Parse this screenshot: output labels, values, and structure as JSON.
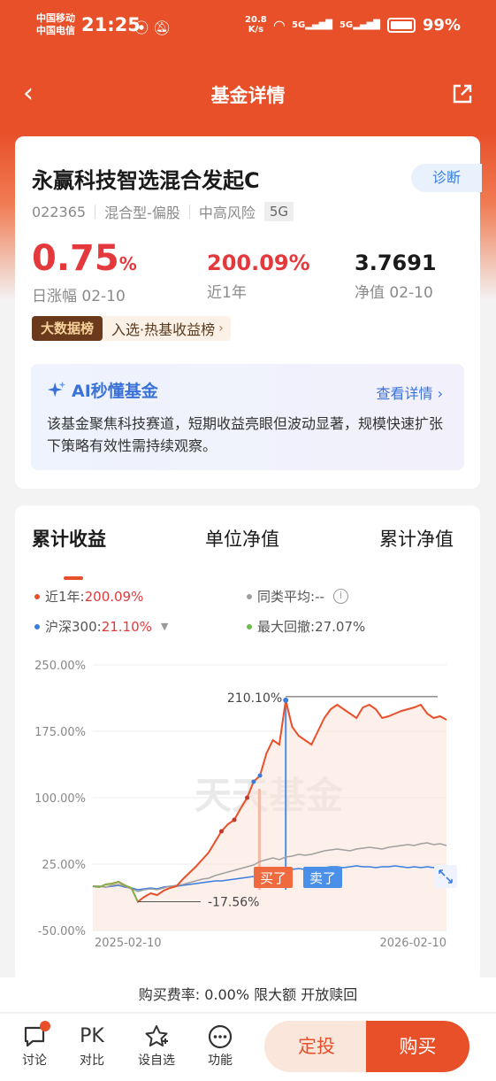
{
  "status_bar": {
    "carrier1": "中国移动",
    "carrier2": "中国电信",
    "time": "21:25",
    "speed": "20.8",
    "speed_unit": "K/s",
    "battery": "99%"
  },
  "nav": {
    "title": "基金详情"
  },
  "fund": {
    "name": "永赢科技智选混合发起C",
    "diagnose_label": "诊断",
    "code": "022365",
    "type": "混合型-偏股",
    "risk": "中高风险",
    "tag": "5G",
    "daily_change_value": "0.75",
    "daily_change_unit": "%",
    "daily_change_label": "日涨幅 02-10",
    "one_year_value": "200.09%",
    "one_year_label": "近1年",
    "nav_value": "3.7691",
    "nav_label": "净值 02-10",
    "rank_tag": "大数据榜",
    "rank_text": "入选·热基收益榜",
    "rank_chevron": "›"
  },
  "ai": {
    "title": "AI秒懂基金",
    "more": "查看详情",
    "more_chevron": "›",
    "text": "该基金聚焦科技赛道，短期收益亮眼但波动显著，规模快速扩张下策略有效性需持续观察。"
  },
  "tabs": [
    "累计收益",
    "单位净值",
    "累计净值"
  ],
  "legend": {
    "fund_label": "近1年:",
    "fund_value": "200.09%",
    "peer_label": "同类平均:",
    "peer_value": "--",
    "index_label": "沪深300:",
    "index_value": "21.10%",
    "drawdown_label": "最大回撤:",
    "drawdown_value": "27.07%"
  },
  "chart_data": {
    "type": "line",
    "y_ticks": [
      "250.00%",
      "175.00%",
      "100.00%",
      "25.00%",
      "-50.00%"
    ],
    "ylim": [
      -50,
      250
    ],
    "x_ticks": [
      "2025-02-10",
      "2026-02-10"
    ],
    "max_label": "210.10%",
    "min_label": "-17.56%",
    "buy_label": "买了",
    "sell_label": "卖了",
    "watermark": "天天基金",
    "series": [
      {
        "name": "近1年",
        "color": "#e8502a",
        "values": [
          0,
          -1,
          2,
          3,
          5,
          1,
          -2,
          -17.56,
          -12,
          -8,
          -10,
          -5,
          -2,
          0,
          8,
          15,
          22,
          30,
          38,
          50,
          62,
          70,
          75,
          88,
          100,
          118,
          125,
          150,
          165,
          160,
          210.1,
          180,
          170,
          165,
          160,
          175,
          190,
          200,
          205,
          200,
          195,
          190,
          202,
          205,
          200,
          190,
          192,
          195,
          198,
          200,
          202,
          205,
          195,
          190,
          192,
          188
        ]
      },
      {
        "name": "同类平均",
        "color": "#a0a0a0",
        "values": [
          0,
          0,
          -1,
          1,
          2,
          0,
          -3,
          -6,
          -4,
          -3,
          -4,
          -2,
          0,
          1,
          2,
          4,
          6,
          8,
          9,
          12,
          14,
          16,
          18,
          20,
          22,
          24,
          28,
          30,
          32,
          30,
          33,
          34,
          36,
          35,
          36,
          38,
          40,
          41,
          42,
          41,
          40,
          42,
          43,
          44,
          43,
          42,
          44,
          45,
          46,
          47,
          46,
          48,
          49,
          47,
          48,
          46
        ]
      },
      {
        "name": "沪深300",
        "color": "#3a7de0",
        "values": [
          0,
          0,
          -1,
          0,
          1,
          -1,
          -2,
          -4,
          -3,
          -2,
          -3,
          -1,
          0,
          0,
          1,
          2,
          3,
          4,
          5,
          6,
          6,
          7,
          8,
          9,
          10,
          11,
          12,
          14,
          16,
          15,
          18,
          19,
          20,
          19,
          20,
          21,
          21,
          22,
          22,
          21,
          22,
          23,
          22,
          22,
          21,
          22,
          22,
          23,
          22,
          21,
          22,
          21,
          22,
          21,
          22,
          21.1
        ]
      },
      {
        "name": "最大回撤",
        "color": "#6cc04a",
        "values": [
          0,
          -1,
          2,
          3,
          5,
          1,
          -2,
          -17.56
        ]
      }
    ]
  },
  "bottom": {
    "fee_text": "购买费率: 0.00% 限大额 开放赎回",
    "items": [
      "讨论",
      "对比",
      "设自选",
      "功能"
    ],
    "pk_icon": "PK",
    "dingtou": "定投",
    "buy": "购买"
  }
}
